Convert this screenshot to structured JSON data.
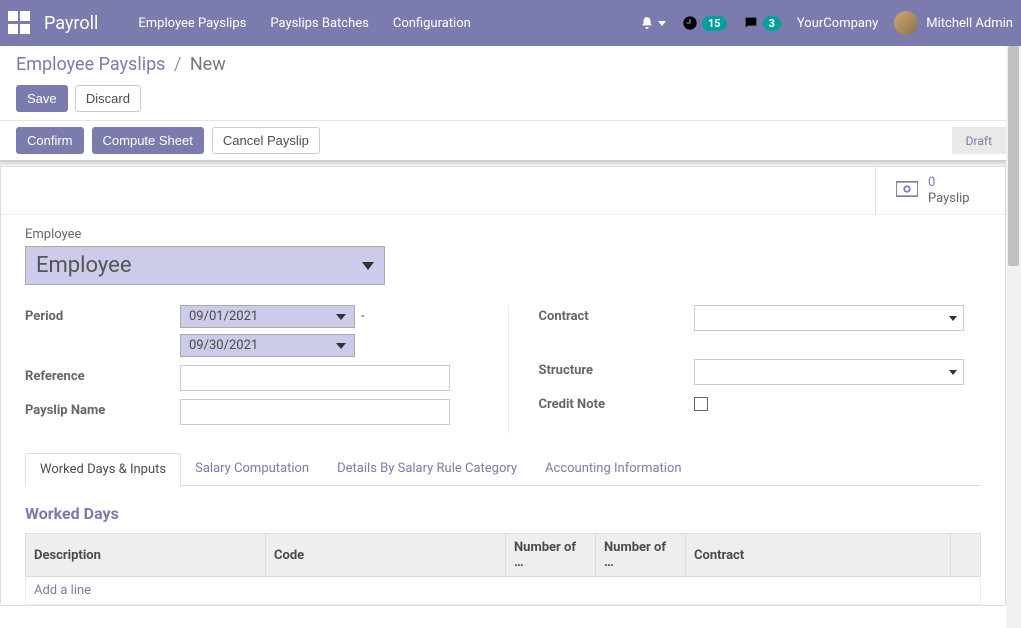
{
  "navbar": {
    "brand": "Payroll",
    "menu": [
      "Employee Payslips",
      "Payslips Batches",
      "Configuration"
    ],
    "activities_count": "15",
    "messages_count": "3",
    "company": "YourCompany",
    "user_name": "Mitchell Admin"
  },
  "breadcrumb": {
    "parent": "Employee Payslips",
    "current": "New"
  },
  "buttons": {
    "save": "Save",
    "discard": "Discard",
    "confirm": "Confirm",
    "compute": "Compute Sheet",
    "cancel": "Cancel Payslip"
  },
  "status": {
    "draft": "Draft"
  },
  "stat": {
    "count": "0",
    "label": "Payslip"
  },
  "form": {
    "employee_label": "Employee",
    "employee_placeholder": "Employee",
    "period_label": "Period",
    "period_from": "09/01/2021",
    "period_to": "09/30/2021",
    "reference_label": "Reference",
    "reference_value": "",
    "payslip_name_label": "Payslip Name",
    "payslip_name_value": "",
    "contract_label": "Contract",
    "structure_label": "Structure",
    "credit_note_label": "Credit Note"
  },
  "tabs": {
    "worked": "Worked Days & Inputs",
    "salary": "Salary Computation",
    "details": "Details By Salary Rule Category",
    "accounting": "Accounting Information"
  },
  "worked_days": {
    "title": "Worked Days",
    "cols": {
      "description": "Description",
      "code": "Code",
      "num_days": "Number of …",
      "num_hours": "Number of …",
      "contract": "Contract"
    },
    "add_line": "Add a line"
  }
}
